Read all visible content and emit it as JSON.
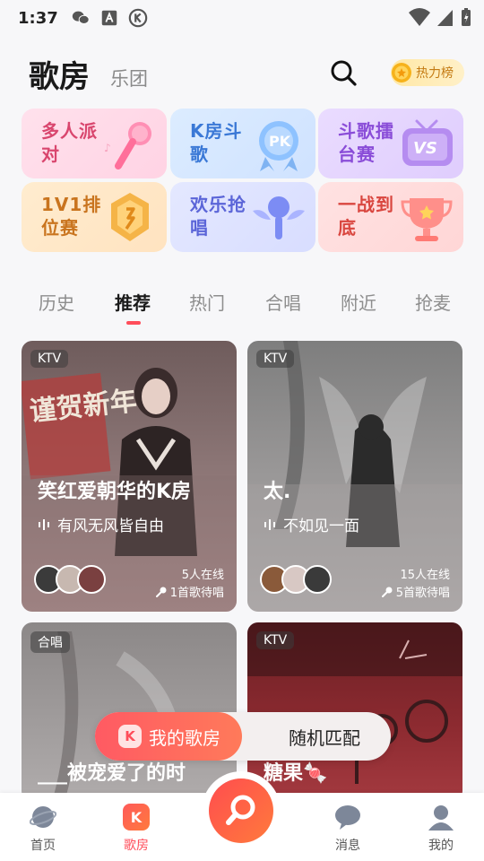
{
  "status": {
    "time": "1:37"
  },
  "header": {
    "title": "歌房",
    "subtitle": "乐团",
    "hot_label": "热力榜"
  },
  "features": [
    {
      "label": "多人派对"
    },
    {
      "label": "K房斗歌"
    },
    {
      "label": "斗歌擂台赛"
    },
    {
      "label": "1V1排位赛"
    },
    {
      "label": "欢乐抢唱"
    },
    {
      "label": "一战到底"
    }
  ],
  "feature_art_text": {
    "pk": "PK",
    "vs": "VS"
  },
  "tabs": [
    "历史",
    "推荐",
    "热门",
    "合唱",
    "附近",
    "抢麦"
  ],
  "rooms": [
    {
      "tag": "KTV",
      "title": "笑红爱朝华的K房",
      "song": "有风无风皆自由",
      "online": "5人在线",
      "queue": "1首歌待唱",
      "banner": "谨贺新年"
    },
    {
      "tag": "KTV",
      "title": "太.",
      "song": "不如见一面",
      "online": "15人在线",
      "queue": "5首歌待唱"
    },
    {
      "tag": "合唱",
      "title": "___被宠爱了的时"
    },
    {
      "tag": "KTV",
      "title": "糖果🍬"
    }
  ],
  "float": {
    "my_room": "我的歌房",
    "my_room_icon": "K",
    "random": "随机匹配"
  },
  "nav": {
    "home": "首页",
    "room": "歌房",
    "room_icon": "K",
    "messages": "消息",
    "mine": "我的"
  },
  "colors": {
    "accent": "#ff4d5a"
  }
}
